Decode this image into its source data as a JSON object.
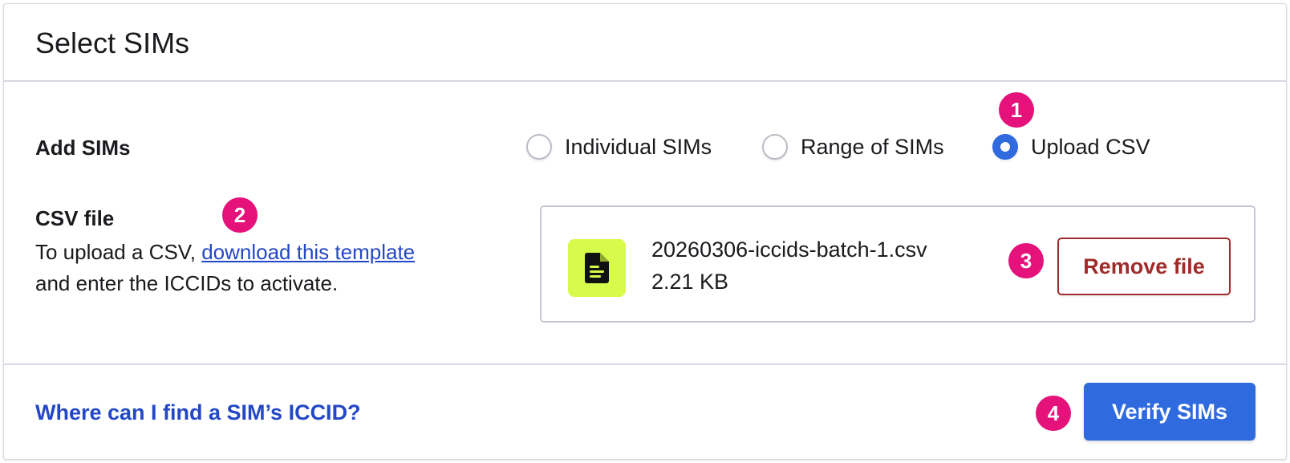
{
  "header": {
    "title": "Select SIMs"
  },
  "add_sims": {
    "label": "Add SIMs",
    "options": [
      {
        "label": "Individual SIMs",
        "checked": false
      },
      {
        "label": "Range of SIMs",
        "checked": false
      },
      {
        "label": "Upload CSV",
        "checked": true
      }
    ]
  },
  "csv": {
    "label": "CSV file",
    "help_prefix": "To upload a CSV, ",
    "help_link": "download this template",
    "help_suffix": "and enter the ICCIDs to activate.",
    "file_name": "20260306-iccids-batch-1.csv",
    "file_size": "2.21 KB",
    "file_icon": "document-icon",
    "remove_label": "Remove file"
  },
  "footer": {
    "help_link": "Where can I find a SIM’s ICCID?",
    "verify_label": "Verify SIMs"
  },
  "badges": [
    "1",
    "2",
    "3",
    "4"
  ],
  "colors": {
    "accent": "#2f6bdf",
    "link": "#2347c6",
    "danger": "#a02b2b",
    "badge": "#e4127a",
    "file_tile": "#d6fb4b"
  }
}
